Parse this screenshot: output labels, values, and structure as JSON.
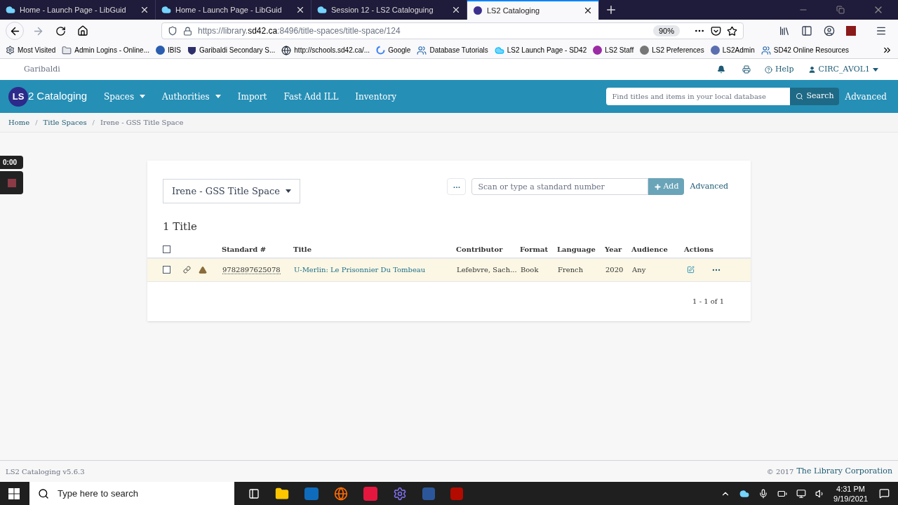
{
  "browser_tabs": [
    {
      "title": "Home - Launch Page - LibGuid",
      "selected": false
    },
    {
      "title": "Home - Launch Page - LibGuid",
      "selected": false
    },
    {
      "title": "Session 12 - LS2 Cataloguing",
      "selected": false
    },
    {
      "title": "LS2 Cataloging",
      "selected": true
    }
  ],
  "address_bar": {
    "url_prefix": "https://library.",
    "url_domain": "sd42.ca",
    "url_rest": ":8496/title-spaces/title-space/124",
    "zoom": "90%"
  },
  "bookmarks": [
    {
      "label": "Most Visited"
    },
    {
      "label": "Admin Logins - Online..."
    },
    {
      "label": "IBIS"
    },
    {
      "label": "Garibaldi Secondary S..."
    },
    {
      "label": "http://schools.sd42.ca/..."
    },
    {
      "label": "Google"
    },
    {
      "label": "Database Tutorials"
    },
    {
      "label": "LS2 Launch Page - SD42"
    },
    {
      "label": "LS2 Staff"
    },
    {
      "label": "LS2 Preferences"
    },
    {
      "label": "LS2Admin"
    },
    {
      "label": "SD42 Online Resources"
    }
  ],
  "app_header": {
    "library": "Garibaldi",
    "help": "Help",
    "user": "CIRC_AVOL1"
  },
  "app_nav": {
    "logo_ls": "LS",
    "logo_2": "2",
    "logo_name": "Cataloging",
    "items": [
      {
        "label": "Spaces",
        "has_menu": true
      },
      {
        "label": "Authorities",
        "has_menu": true
      },
      {
        "label": "Import",
        "has_menu": false
      },
      {
        "label": "Fast Add ILL",
        "has_menu": false
      },
      {
        "label": "Inventory",
        "has_menu": false
      }
    ],
    "search_placeholder": "Find titles and items in your local database",
    "search_button": "Search",
    "advanced": "Advanced"
  },
  "breadcrumb_separator": "/",
  "breadcrumb": [
    {
      "label": "Home",
      "current": false
    },
    {
      "label": "Title Spaces",
      "current": false
    },
    {
      "label": "Irene - GSS Title Space",
      "current": true
    }
  ],
  "recorder": {
    "time": "0:00"
  },
  "title_space": {
    "selector": "Irene - GSS Title Space",
    "more": "···",
    "scan_placeholder": "Scan or type a standard number",
    "add_button": "Add",
    "advanced": "Advanced",
    "count": "1 Title",
    "all_checked": false,
    "columns": [
      "Standard #",
      "Title",
      "Contributor",
      "Format",
      "Language",
      "Year",
      "Audience",
      "Actions"
    ],
    "rows": [
      {
        "checked": false,
        "highlighted": true,
        "standard": "9782897625078",
        "title": "U-Merlin: Le Prisonnier Du Tombeau",
        "contributor": "Lefebvre, Sach...",
        "format": "Book",
        "language": "French",
        "year": "2020",
        "audience": "Any"
      }
    ],
    "pagination": "1 - 1 of 1"
  },
  "footer": {
    "version": "LS2 Cataloging v5.6.3",
    "copyright": "© 2017",
    "company": "The Library Corporation"
  },
  "taskbar": {
    "search_placeholder": "Type here to search",
    "time": "4:31 PM",
    "date": "9/19/2021"
  }
}
